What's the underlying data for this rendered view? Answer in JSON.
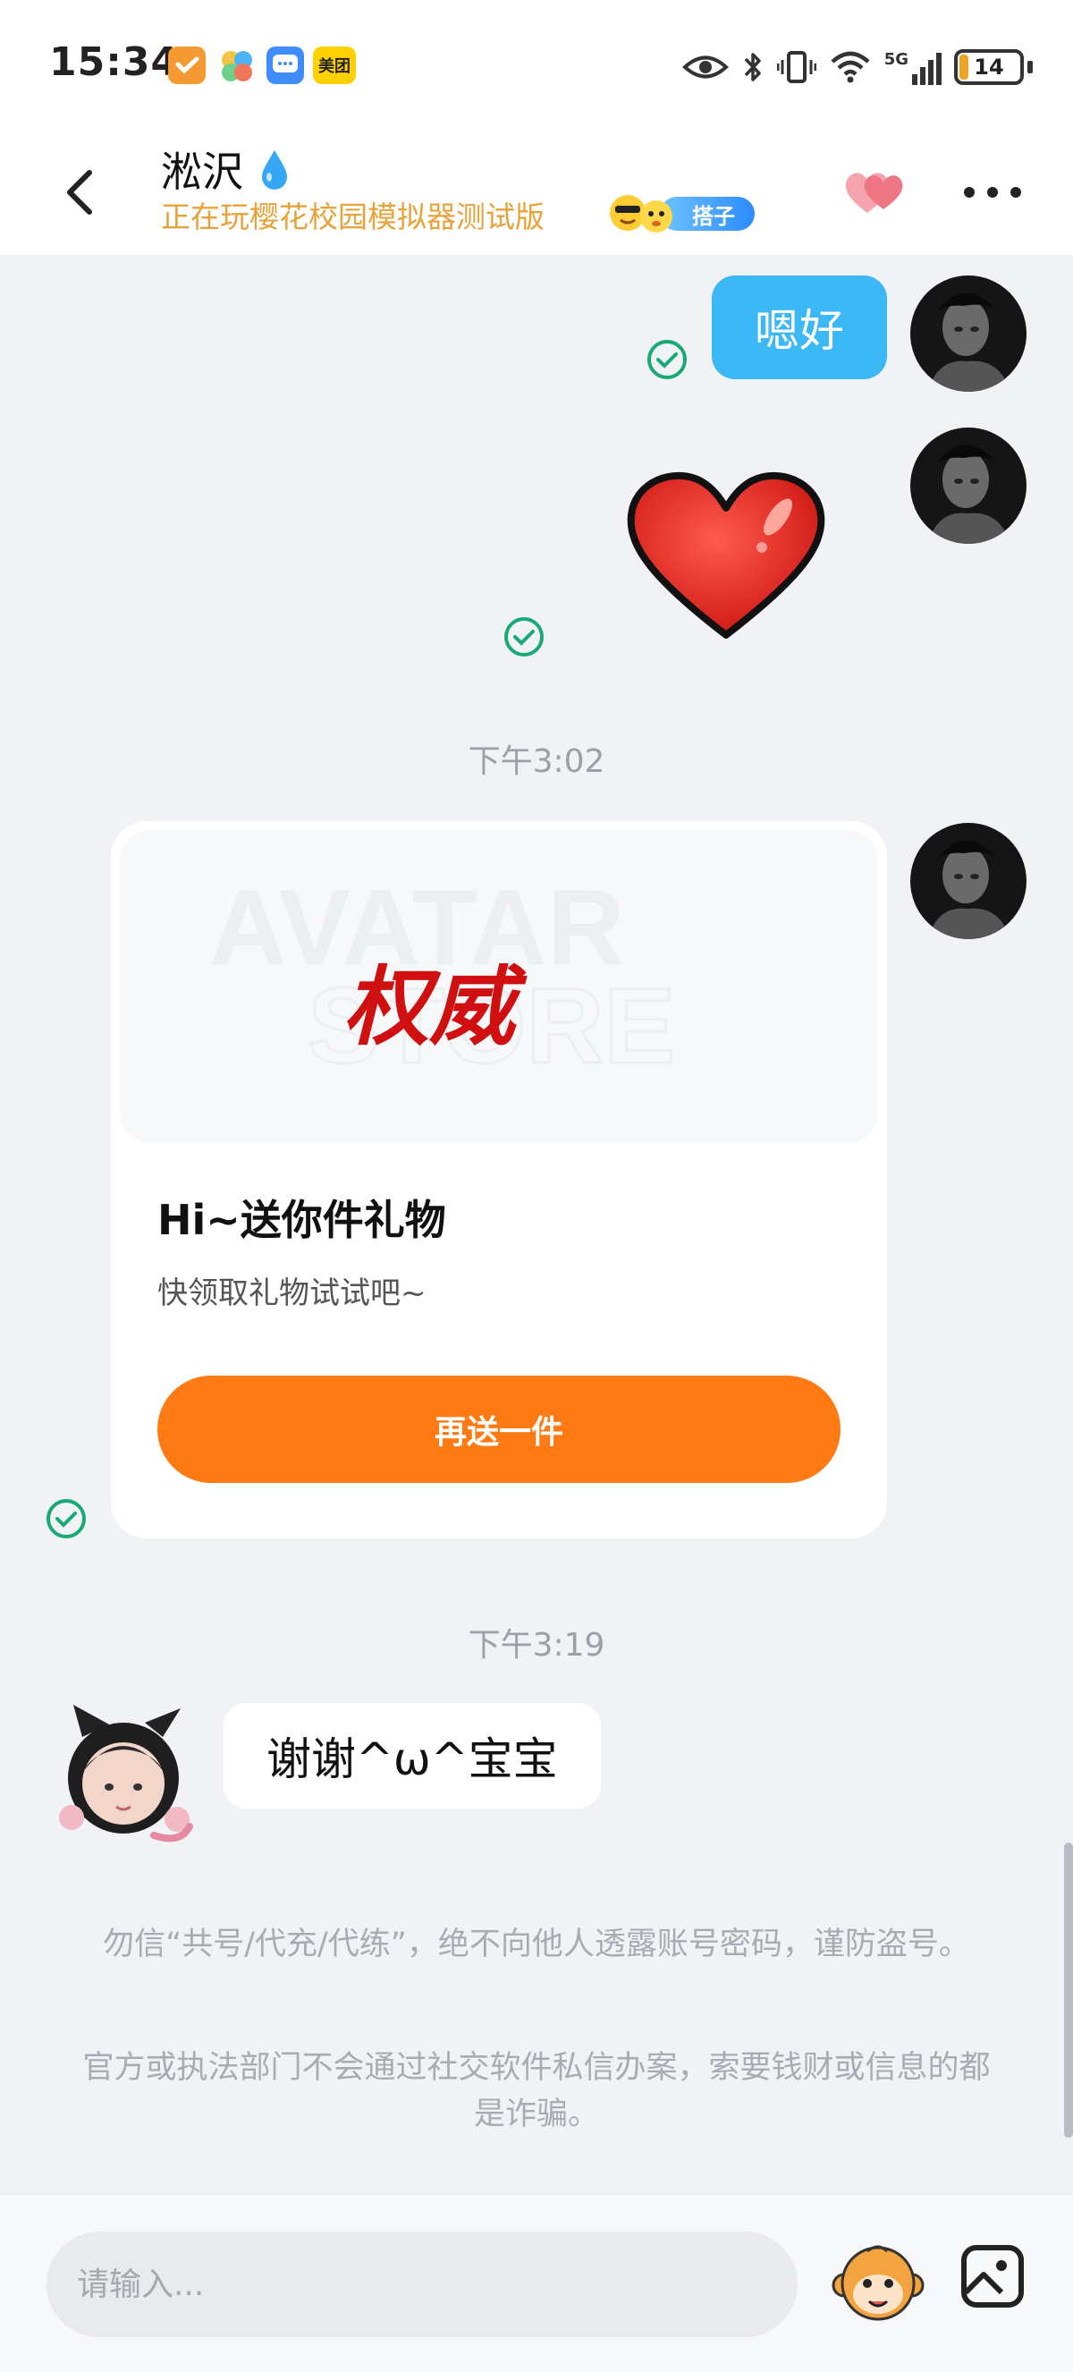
{
  "status_bar": {
    "time": "15:34",
    "app_badge": "美团",
    "battery_level": "14",
    "network": "5G"
  },
  "header": {
    "contact_name": "淞沢",
    "contact_status": "正在玩樱花校园模拟器测试版",
    "pill_label": "搭子"
  },
  "messages": {
    "outgoing_text": "嗯好",
    "timestamp_1": "下午3:02",
    "gift_title": "Hi~送你件礼物",
    "gift_desc": "快领取礼物试试吧~",
    "gift_button": "再送一件",
    "gift_banner_text": "权威",
    "timestamp_2": "下午3:19",
    "incoming_text": "谢谢^ω^宝宝"
  },
  "notices": {
    "notice_1": "勿信“共号/代充/代练”，绝不向他人透露账号密码，谨防盗号。",
    "notice_2": "官方或执法部门不会通过社交软件私信办案，索要钱财或信息的都是诈骗。"
  },
  "input": {
    "placeholder": "请输入..."
  },
  "colors": {
    "accent_blue": "#3cb8f6",
    "accent_orange": "#ff7a12",
    "status_orange": "#e8a23a",
    "check_green": "#19a974"
  }
}
